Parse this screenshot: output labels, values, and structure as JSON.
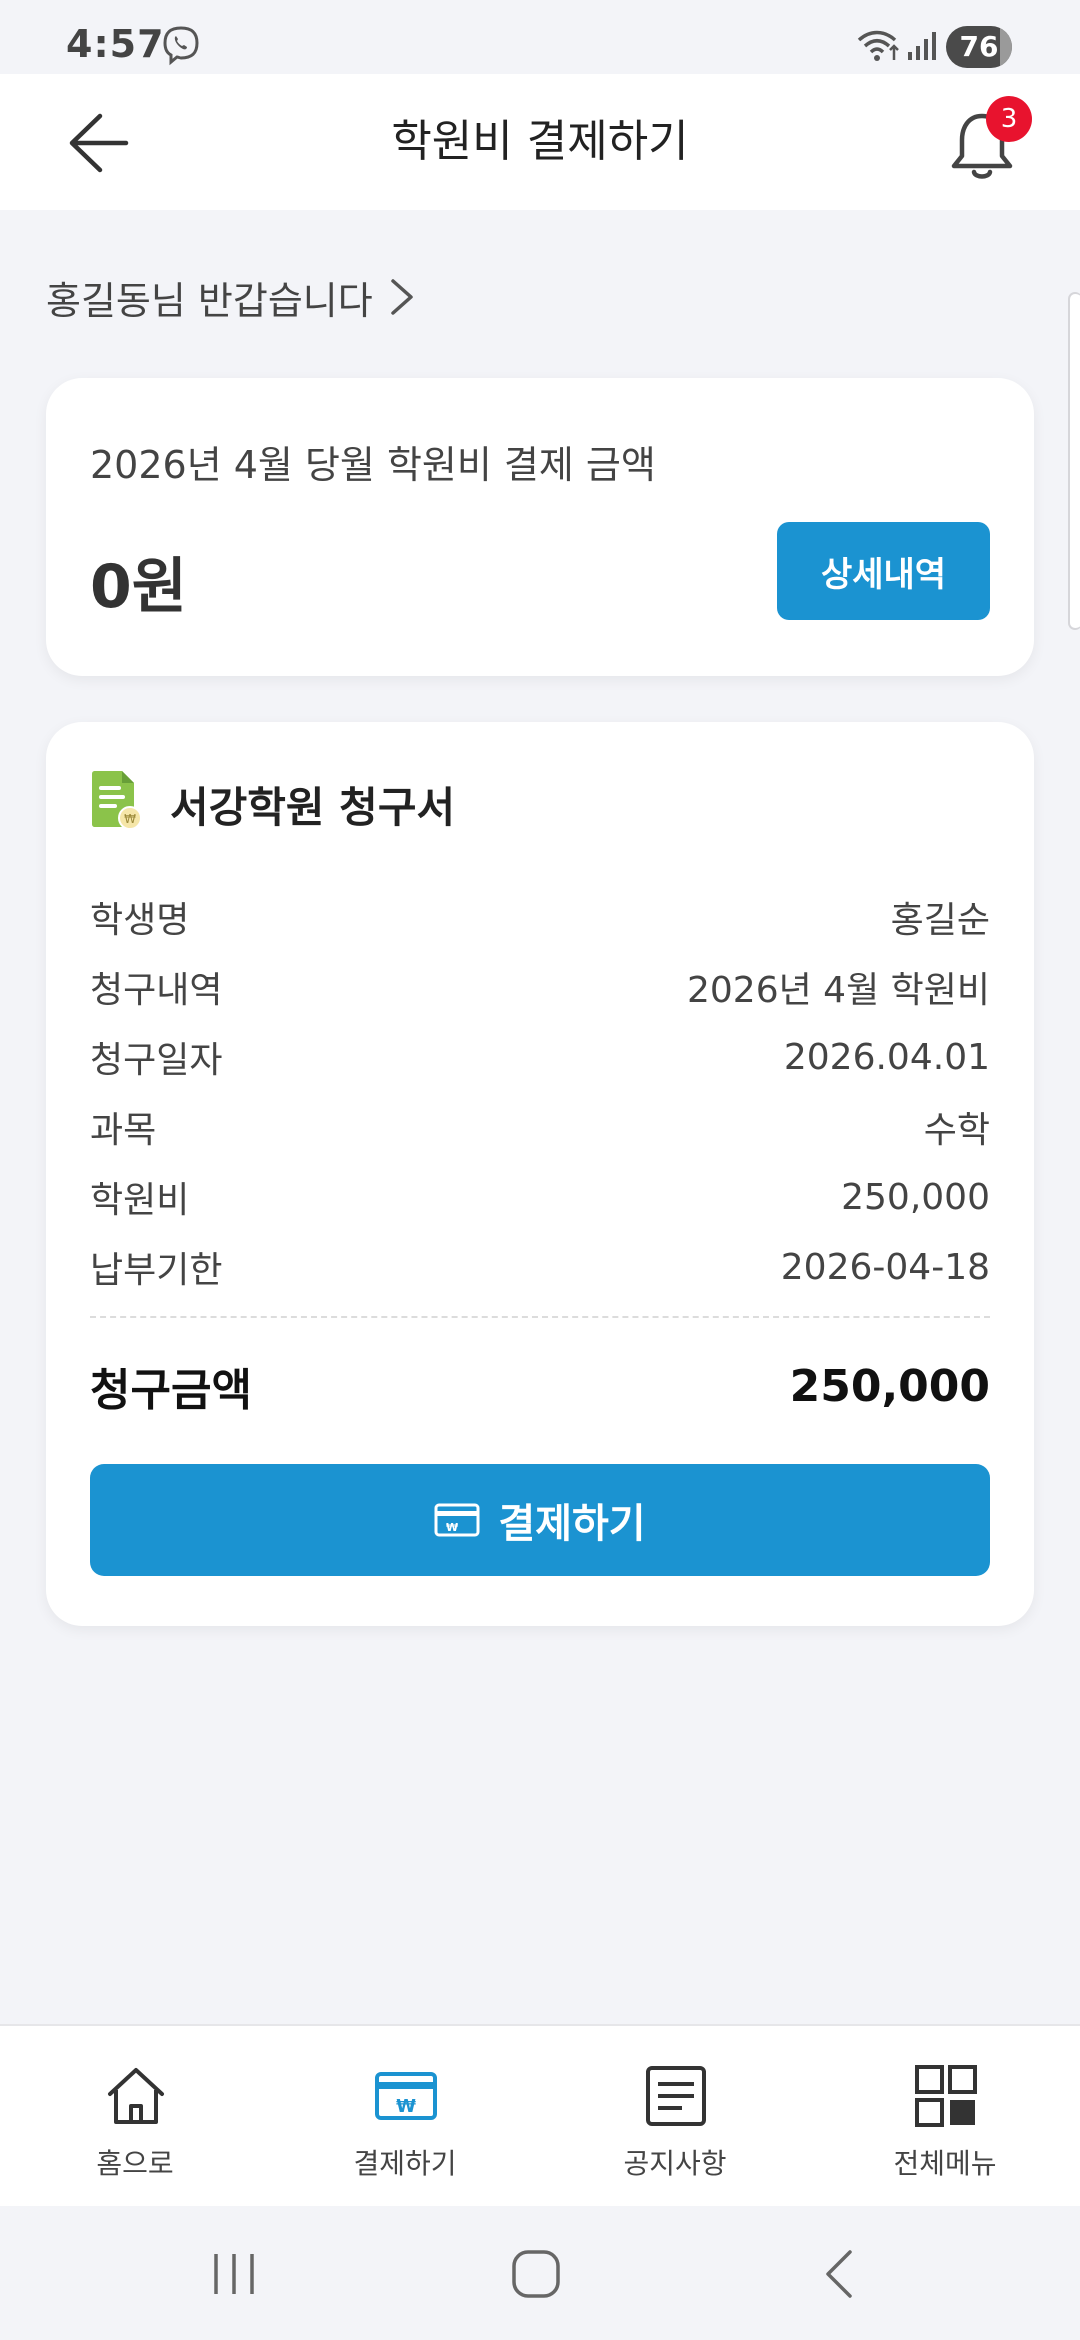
{
  "status_bar": {
    "time": "4:57",
    "battery": "76"
  },
  "header": {
    "title": "학원비 결제하기",
    "notification_count": "3"
  },
  "greeting": "홍길동님 반갑습니다",
  "summary": {
    "label": "2026년 4월 당월 학원비 결제 금액",
    "amount": "0원",
    "detail_button": "상세내역"
  },
  "invoice": {
    "title": "서강학원 청구서",
    "rows": [
      {
        "label": "학생명",
        "value": "홍길순"
      },
      {
        "label": "청구내역",
        "value": "2026년 4월 학원비"
      },
      {
        "label": "청구일자",
        "value": "2026.04.01"
      },
      {
        "label": "과목",
        "value": "수학"
      },
      {
        "label": "학원비",
        "value": "250,000"
      },
      {
        "label": "납부기한",
        "value": "2026-04-18"
      }
    ],
    "total_label": "청구금액",
    "total_value": "250,000",
    "pay_button": "결제하기"
  },
  "bottom_nav": [
    {
      "label": "홈으로",
      "icon": "home-icon"
    },
    {
      "label": "결제하기",
      "icon": "payment-card-icon"
    },
    {
      "label": "공지사항",
      "icon": "notice-icon"
    },
    {
      "label": "전체메뉴",
      "icon": "grid-menu-icon"
    }
  ],
  "colors": {
    "accent": "#1B93D1",
    "badge": "#E8132E",
    "background": "#F3F4F8"
  }
}
